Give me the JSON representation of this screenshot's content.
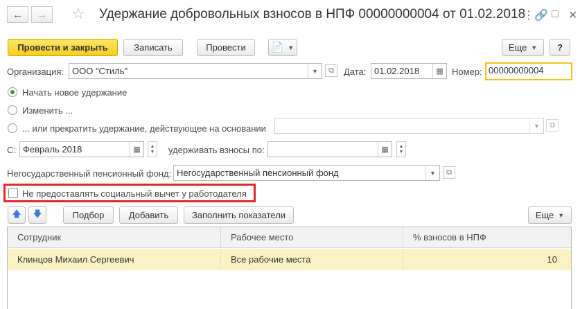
{
  "title": "Удержание добровольных взносов в НПФ 00000000004 от 01.02.2018",
  "nav": {
    "back_icon": "arrow-left-icon",
    "forward_icon": "arrow-right-icon",
    "favorite_icon": "star-icon"
  },
  "window": {
    "menu_icon": "kebab-menu-icon",
    "link_icon": "link-icon",
    "maximize_icon": "maximize-icon",
    "close_icon": "close-icon"
  },
  "toolbar": {
    "post_close": "Провести и закрыть",
    "save": "Записать",
    "post": "Провести",
    "more": "Еще",
    "help": "?"
  },
  "header": {
    "org_label": "Организация:",
    "org_value": "ООО \"Стиль\"",
    "date_label": "Дата:",
    "date_value": "01.02.2018",
    "number_label": "Номер:",
    "number_value": "00000000004"
  },
  "options": {
    "new": "Начать новое удержание",
    "change": "Изменить ...",
    "stop": "... или прекратить удержание, действующее на основании",
    "stop_value": ""
  },
  "period": {
    "from_label": "С:",
    "from_value": "Февраль 2018",
    "until_label": "удерживать взносы по:",
    "until_value": ""
  },
  "fund": {
    "label": "Негосударственный пенсионный фонд:",
    "value": "Негосударственный пенсионный фонд"
  },
  "deduction_checkbox": {
    "label": "Не предоставлять социальный вычет у работодателя",
    "checked": false
  },
  "table_toolbar": {
    "select": "Подбор",
    "add": "Добавить",
    "fill": "Заполнить показатели",
    "more": "Еще"
  },
  "table": {
    "headers": [
      "Сотрудник",
      "Рабочее место",
      "% взносов в НПФ"
    ],
    "rows": [
      {
        "employee": "Клинцов Михаил Сергеевич",
        "workplace": "Все рабочие места",
        "percent": "10"
      }
    ]
  },
  "colors": {
    "accent": "#f6cf1b",
    "highlight": "#e32727",
    "selected_row": "#fbf2c3"
  }
}
